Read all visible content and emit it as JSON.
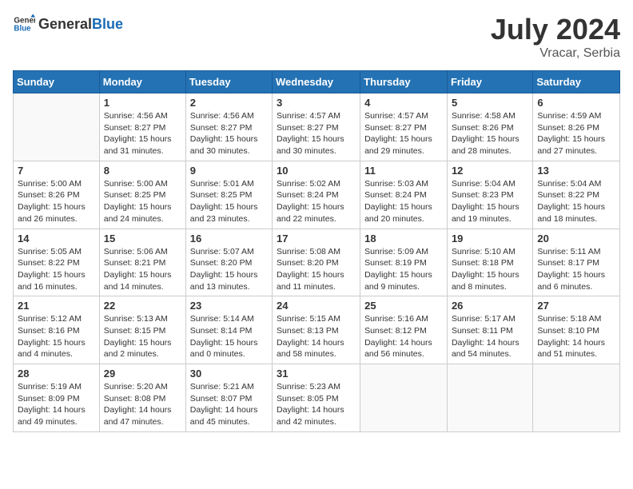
{
  "header": {
    "logo_general": "General",
    "logo_blue": "Blue",
    "month_year": "July 2024",
    "location": "Vracar, Serbia"
  },
  "calendar": {
    "days_of_week": [
      "Sunday",
      "Monday",
      "Tuesday",
      "Wednesday",
      "Thursday",
      "Friday",
      "Saturday"
    ],
    "weeks": [
      [
        {
          "day": "",
          "info": ""
        },
        {
          "day": "1",
          "info": "Sunrise: 4:56 AM\nSunset: 8:27 PM\nDaylight: 15 hours\nand 31 minutes."
        },
        {
          "day": "2",
          "info": "Sunrise: 4:56 AM\nSunset: 8:27 PM\nDaylight: 15 hours\nand 30 minutes."
        },
        {
          "day": "3",
          "info": "Sunrise: 4:57 AM\nSunset: 8:27 PM\nDaylight: 15 hours\nand 30 minutes."
        },
        {
          "day": "4",
          "info": "Sunrise: 4:57 AM\nSunset: 8:27 PM\nDaylight: 15 hours\nand 29 minutes."
        },
        {
          "day": "5",
          "info": "Sunrise: 4:58 AM\nSunset: 8:26 PM\nDaylight: 15 hours\nand 28 minutes."
        },
        {
          "day": "6",
          "info": "Sunrise: 4:59 AM\nSunset: 8:26 PM\nDaylight: 15 hours\nand 27 minutes."
        }
      ],
      [
        {
          "day": "7",
          "info": "Sunrise: 5:00 AM\nSunset: 8:26 PM\nDaylight: 15 hours\nand 26 minutes."
        },
        {
          "day": "8",
          "info": "Sunrise: 5:00 AM\nSunset: 8:25 PM\nDaylight: 15 hours\nand 24 minutes."
        },
        {
          "day": "9",
          "info": "Sunrise: 5:01 AM\nSunset: 8:25 PM\nDaylight: 15 hours\nand 23 minutes."
        },
        {
          "day": "10",
          "info": "Sunrise: 5:02 AM\nSunset: 8:24 PM\nDaylight: 15 hours\nand 22 minutes."
        },
        {
          "day": "11",
          "info": "Sunrise: 5:03 AM\nSunset: 8:24 PM\nDaylight: 15 hours\nand 20 minutes."
        },
        {
          "day": "12",
          "info": "Sunrise: 5:04 AM\nSunset: 8:23 PM\nDaylight: 15 hours\nand 19 minutes."
        },
        {
          "day": "13",
          "info": "Sunrise: 5:04 AM\nSunset: 8:22 PM\nDaylight: 15 hours\nand 18 minutes."
        }
      ],
      [
        {
          "day": "14",
          "info": "Sunrise: 5:05 AM\nSunset: 8:22 PM\nDaylight: 15 hours\nand 16 minutes."
        },
        {
          "day": "15",
          "info": "Sunrise: 5:06 AM\nSunset: 8:21 PM\nDaylight: 15 hours\nand 14 minutes."
        },
        {
          "day": "16",
          "info": "Sunrise: 5:07 AM\nSunset: 8:20 PM\nDaylight: 15 hours\nand 13 minutes."
        },
        {
          "day": "17",
          "info": "Sunrise: 5:08 AM\nSunset: 8:20 PM\nDaylight: 15 hours\nand 11 minutes."
        },
        {
          "day": "18",
          "info": "Sunrise: 5:09 AM\nSunset: 8:19 PM\nDaylight: 15 hours\nand 9 minutes."
        },
        {
          "day": "19",
          "info": "Sunrise: 5:10 AM\nSunset: 8:18 PM\nDaylight: 15 hours\nand 8 minutes."
        },
        {
          "day": "20",
          "info": "Sunrise: 5:11 AM\nSunset: 8:17 PM\nDaylight: 15 hours\nand 6 minutes."
        }
      ],
      [
        {
          "day": "21",
          "info": "Sunrise: 5:12 AM\nSunset: 8:16 PM\nDaylight: 15 hours\nand 4 minutes."
        },
        {
          "day": "22",
          "info": "Sunrise: 5:13 AM\nSunset: 8:15 PM\nDaylight: 15 hours\nand 2 minutes."
        },
        {
          "day": "23",
          "info": "Sunrise: 5:14 AM\nSunset: 8:14 PM\nDaylight: 15 hours\nand 0 minutes."
        },
        {
          "day": "24",
          "info": "Sunrise: 5:15 AM\nSunset: 8:13 PM\nDaylight: 14 hours\nand 58 minutes."
        },
        {
          "day": "25",
          "info": "Sunrise: 5:16 AM\nSunset: 8:12 PM\nDaylight: 14 hours\nand 56 minutes."
        },
        {
          "day": "26",
          "info": "Sunrise: 5:17 AM\nSunset: 8:11 PM\nDaylight: 14 hours\nand 54 minutes."
        },
        {
          "day": "27",
          "info": "Sunrise: 5:18 AM\nSunset: 8:10 PM\nDaylight: 14 hours\nand 51 minutes."
        }
      ],
      [
        {
          "day": "28",
          "info": "Sunrise: 5:19 AM\nSunset: 8:09 PM\nDaylight: 14 hours\nand 49 minutes."
        },
        {
          "day": "29",
          "info": "Sunrise: 5:20 AM\nSunset: 8:08 PM\nDaylight: 14 hours\nand 47 minutes."
        },
        {
          "day": "30",
          "info": "Sunrise: 5:21 AM\nSunset: 8:07 PM\nDaylight: 14 hours\nand 45 minutes."
        },
        {
          "day": "31",
          "info": "Sunrise: 5:23 AM\nSunset: 8:05 PM\nDaylight: 14 hours\nand 42 minutes."
        },
        {
          "day": "",
          "info": ""
        },
        {
          "day": "",
          "info": ""
        },
        {
          "day": "",
          "info": ""
        }
      ]
    ]
  }
}
